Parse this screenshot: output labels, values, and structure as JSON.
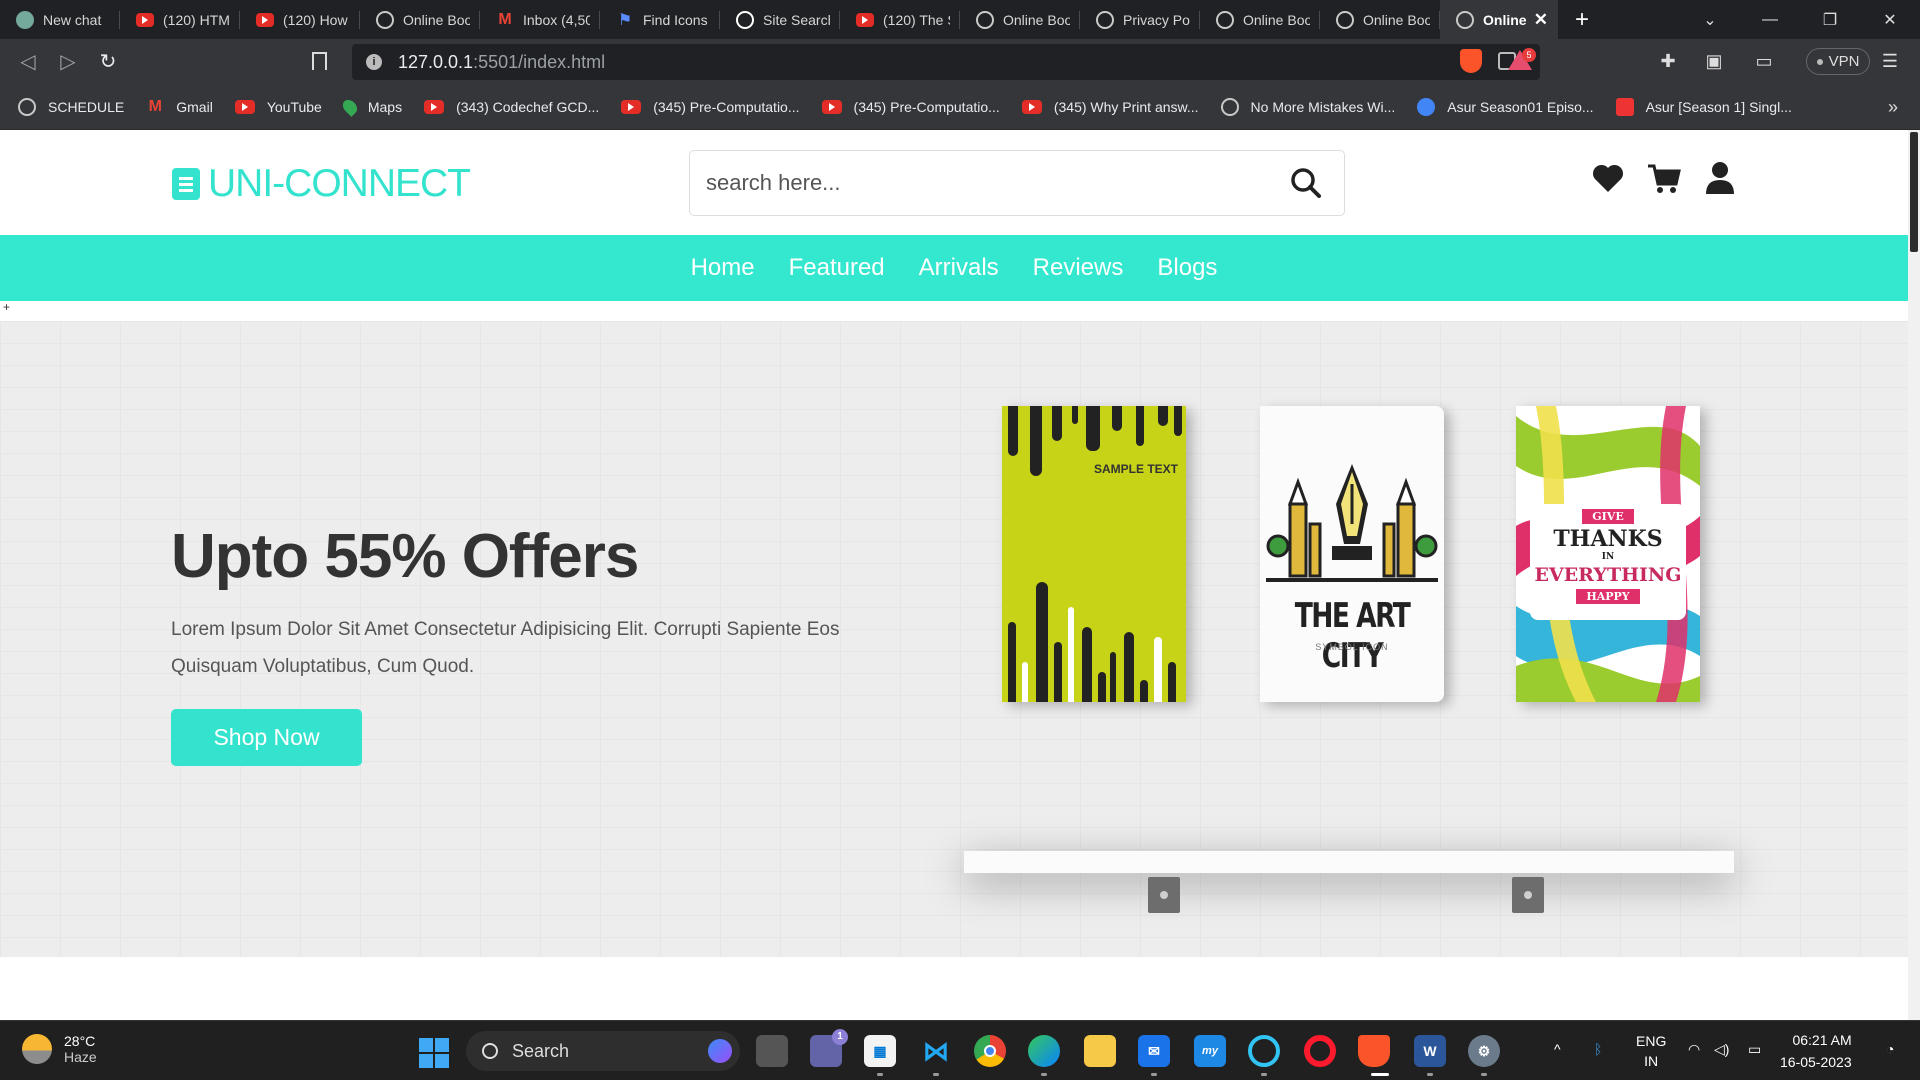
{
  "browser": {
    "tabs": [
      {
        "title": "New chat",
        "icon": "chatgpt-icon"
      },
      {
        "title": "(120) HTML",
        "icon": "youtube-icon"
      },
      {
        "title": "(120) How",
        "icon": "youtube-icon"
      },
      {
        "title": "Online Boo",
        "icon": "globe-icon"
      },
      {
        "title": "Inbox (4,50",
        "icon": "gmail-icon"
      },
      {
        "title": "Find Icons",
        "icon": "flag-icon"
      },
      {
        "title": "Site Search",
        "icon": "site-search-icon"
      },
      {
        "title": "(120) The S",
        "icon": "youtube-icon"
      },
      {
        "title": "Online Boo",
        "icon": "globe-icon"
      },
      {
        "title": "Privacy Poli",
        "icon": "globe-icon"
      },
      {
        "title": "Online Boo",
        "icon": "globe-icon"
      },
      {
        "title": "Online Boo",
        "icon": "globe-icon"
      },
      {
        "title": "Online",
        "icon": "globe-icon",
        "active": true
      }
    ],
    "new_tab": "+",
    "url_host": "127.0.0.1",
    "url_rest": ":5501/index.html",
    "vpn_label": "VPN",
    "rewards_badge": "5",
    "bookmarks": [
      {
        "label": "SCHEDULE",
        "icon": "globe-icon"
      },
      {
        "label": "Gmail",
        "icon": "gmail-icon"
      },
      {
        "label": "YouTube",
        "icon": "youtube-icon"
      },
      {
        "label": "Maps",
        "icon": "maps-icon"
      },
      {
        "label": "(343) Codechef GCD...",
        "icon": "youtube-icon"
      },
      {
        "label": "(345) Pre-Computatio...",
        "icon": "youtube-icon"
      },
      {
        "label": "(345) Pre-Computatio...",
        "icon": "youtube-icon"
      },
      {
        "label": "(345) Why Print answ...",
        "icon": "youtube-icon"
      },
      {
        "label": "No More Mistakes Wi...",
        "icon": "globe-icon"
      },
      {
        "label": "Asur Season01 Episo...",
        "icon": "drive-icon"
      },
      {
        "label": "Asur [Season 1] Singl...",
        "icon": "red-site-icon"
      }
    ],
    "bookmarks_more": "»"
  },
  "site": {
    "logo_text": "UNI-CONNECT",
    "search_placeholder": "search here...",
    "nav": [
      "Home",
      "Featured",
      "Arrivals",
      "Reviews",
      "Blogs"
    ],
    "plus_mark": "+",
    "hero": {
      "title": "Upto 55% Offers",
      "text": "Lorem Ipsum Dolor Sit Amet Consectetur Adipisicing Elit. Corrupti Sapiente Eos Quisquam Voluptatibus, Cum Quod.",
      "button": "Shop Now"
    },
    "books": {
      "book1_text": "SAMPLE TEXT",
      "book2_title": "THE ART CITY",
      "book2_sub": "SYMBOL ICON",
      "book3_give": "GIVE",
      "book3_thanks": "THANKS",
      "book3_in": "IN",
      "book3_everything": "EVERYTHING",
      "book3_happy": "HAPPY"
    }
  },
  "taskbar": {
    "weather_temp": "28°C",
    "weather_cond": "Haze",
    "search_label": "Search",
    "lang": "ENG",
    "region": "IN",
    "time": "06:21 AM",
    "date": "16-05-2023",
    "teams_badge": "1"
  },
  "colors": {
    "accent": "#34e3cd",
    "nav_bg": "#34e8cf",
    "heading": "#333333"
  }
}
